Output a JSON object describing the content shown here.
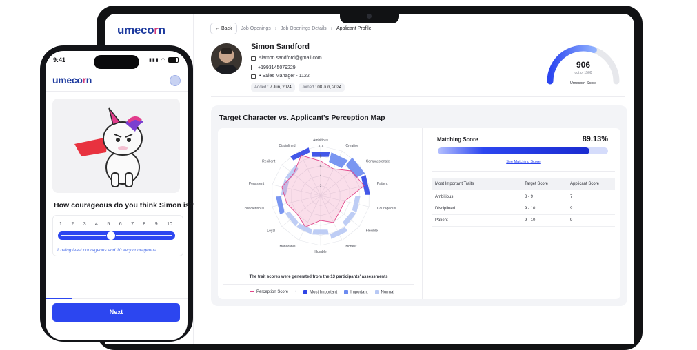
{
  "colors": {
    "brand_blue": "#2c46f0",
    "brand_pink": "#d23a7a",
    "most_important": "#2f45e6",
    "important": "#6c8bf0",
    "normal": "#b7c8f4",
    "perception": "#e2478a"
  },
  "brand": {
    "name_a": "umeco",
    "name_dot": "r",
    "name_b": "n"
  },
  "breadcrumb": {
    "back": "Back",
    "items": [
      "Job Openings",
      "Job Openings Details",
      "Applicant Profile"
    ]
  },
  "applicant": {
    "name": "Simon Sandford",
    "email": "siamon.sandford@gmail.com",
    "phone": "+1993145079229",
    "role": "• Sales Manager - 1122",
    "added_label": "Added :",
    "added": "7 Jun, 2024",
    "joined_label": "Joined :",
    "joined": "08 Jun, 2024"
  },
  "score": {
    "value": "906",
    "out_of": "out of 1500",
    "label": "Umecorn Score",
    "fraction": 0.604
  },
  "map_card": {
    "title": "Target Character vs. Applicant's Perception Map",
    "footnote": "The trait scores were generated from the 13 participants' assessments",
    "legend": [
      "Perception Score",
      "Most Important",
      "Important",
      "Normal"
    ],
    "radar_ticks": [
      "10",
      "8",
      "6",
      "4",
      "2"
    ]
  },
  "radar": {
    "traits": [
      "Ambitious",
      "Creative",
      "Compassionate",
      "Patient",
      "Courageous",
      "Flexible",
      "Honest",
      "Humble",
      "Honorable",
      "Loyal",
      "Conscientious",
      "Persistent",
      "Resilient",
      "Disciplined"
    ],
    "importance": [
      "most",
      "important",
      "important",
      "most",
      "normal",
      "normal",
      "normal",
      "normal",
      "normal",
      "normal",
      "important",
      "normal",
      "normal",
      "most"
    ],
    "target_low": [
      8,
      7,
      8,
      9,
      7,
      7,
      8,
      7,
      7,
      7,
      8,
      7,
      7,
      9
    ],
    "target_high": [
      9,
      9,
      10,
      10,
      8,
      8,
      9,
      8,
      8,
      8,
      9,
      8,
      8,
      10
    ],
    "perception": [
      7,
      6,
      8,
      9,
      5,
      5,
      6,
      5,
      7,
      6,
      7,
      8,
      7,
      9
    ]
  },
  "matching": {
    "label": "Matching Score",
    "value": "89.13%",
    "fraction": 0.8913,
    "link": "See Matching Score"
  },
  "traits_table": {
    "headers": [
      "Most Important Traits",
      "Target Score",
      "Applicant Score"
    ],
    "rows": [
      [
        "Ambitious",
        "8 - 9",
        "7"
      ],
      [
        "Disciplined",
        "9 - 10",
        "9"
      ],
      [
        "Patient",
        "9 - 10",
        "9"
      ]
    ]
  },
  "phone": {
    "time": "9:41",
    "question": "How courageous do you think Simon is?",
    "scale": [
      "1",
      "2",
      "3",
      "4",
      "5",
      "6",
      "7",
      "8",
      "9",
      "10"
    ],
    "selected_value": 5,
    "hint": "1 being least courageous and 10 very courageous",
    "next": "Next",
    "progress_fraction": 0.19
  }
}
